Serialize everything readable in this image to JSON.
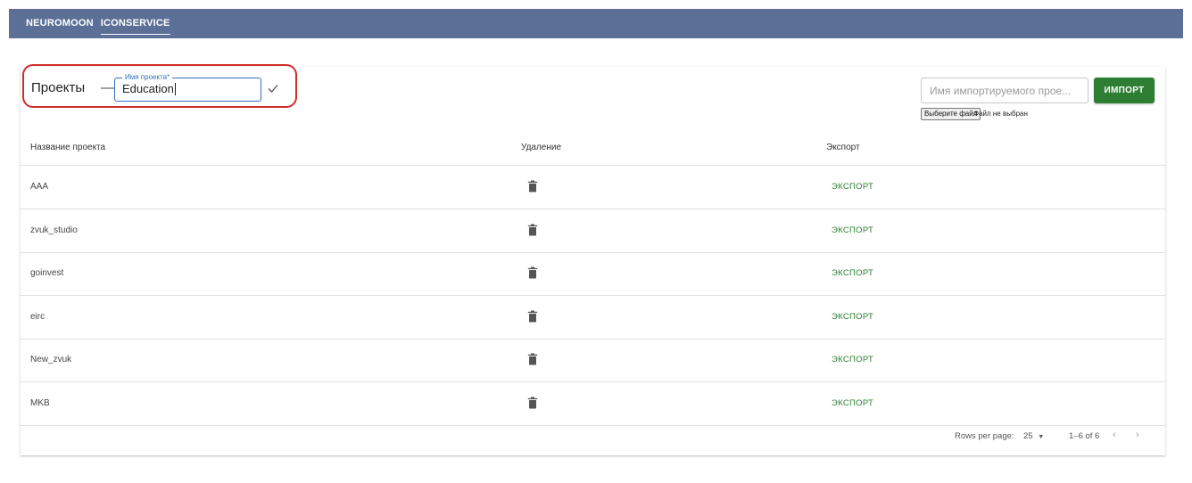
{
  "nav": {
    "items": [
      {
        "label": "NEUROMOON"
      },
      {
        "label": "ICONSERVICE"
      }
    ]
  },
  "header": {
    "title": "Проекты",
    "separator": "—",
    "project_field_label": "Имя проекта*",
    "project_field_value": "Education"
  },
  "import": {
    "placeholder": "Имя импортируемого прое...",
    "button_label": "ИМПОРТ",
    "file_button": "Выберите файл",
    "file_status": "Файл не выбран"
  },
  "table": {
    "columns": [
      "Название проекта",
      "Удаление",
      "Экспорт"
    ],
    "rows": [
      {
        "name": "AAA",
        "export": "ЭКСПОРТ"
      },
      {
        "name": "zvuk_studio",
        "export": "ЭКСПОРТ"
      },
      {
        "name": "goinvest",
        "export": "ЭКСПОРТ"
      },
      {
        "name": "eirc",
        "export": "ЭКСПОРТ"
      },
      {
        "name": "New_zvuk",
        "export": "ЭКСПОРТ"
      },
      {
        "name": "MKB",
        "export": "ЭКСПОРТ"
      }
    ]
  },
  "pagination": {
    "rows_per_page_label": "Rows per page:",
    "rows_per_page_value": "25",
    "range": "1–6 of 6",
    "prev_icon": "chevron-left-icon",
    "next_icon": "chevron-right-icon"
  },
  "colors": {
    "topbar": "#5b6f97",
    "accent_green": "#2d7d32",
    "focus_blue": "#2f6fc5",
    "highlight_red": "#d22b2b"
  }
}
